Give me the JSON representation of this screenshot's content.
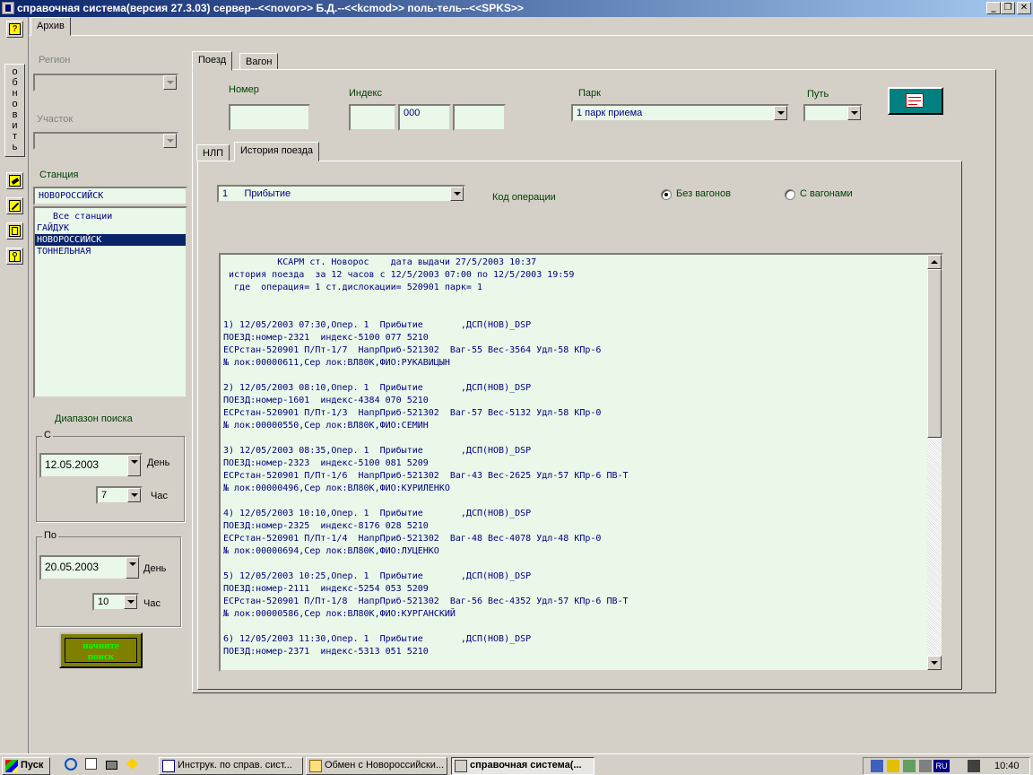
{
  "window": {
    "title": "справочная система(версия 27.3.03) сервер--<<novor>> Б.Д.--<<kcmod>> поль-тель--<<SPKS>>",
    "controls": [
      "_",
      "❐",
      "✕"
    ]
  },
  "toolbar": {
    "help_label": "?",
    "refresh_label": "о\nб\nн\nо\nв\nи\nт\nь",
    "icons": [
      "eraser-icon",
      "pencil-icon",
      "cabinet-icon",
      "key-icon"
    ]
  },
  "top_tab": {
    "label": "Архив"
  },
  "left": {
    "region_label": "Регион",
    "region_value": "",
    "section_label": "Участок",
    "section_value": "",
    "station_label": "Станция",
    "station_value": "НОВОРОССИЙСК",
    "stations": [
      "   Все станции",
      "ГАЙДУК",
      "НОВОРОССИЙСК",
      "ТОННЕЛЬНАЯ"
    ],
    "selected_station_index": 2,
    "range_label": "Диапазон поиска",
    "from": {
      "group_label": "С",
      "date": "12.05.2003",
      "day_label": "День",
      "hour": "7",
      "hour_label": "Час"
    },
    "to": {
      "group_label": "По",
      "date": "20.05.2003",
      "day_label": "День",
      "hour": "10",
      "hour_label": "Час"
    },
    "start_button": "начните\nпоиск"
  },
  "main": {
    "tabs": [
      "Поезд",
      "Вагон"
    ],
    "number_label": "Номер",
    "number_value": "",
    "index_label": "Индекс",
    "index_values": [
      "",
      "000",
      ""
    ],
    "park_label": "Парк",
    "park_value": "1  парк приема",
    "track_label": "Путь",
    "track_value": "",
    "subtabs": [
      "НЛП",
      "История поезда"
    ],
    "operation_value": "1      Прибытие",
    "operation_label": "Код операции",
    "radio_without": "Без вагонов",
    "radio_with": "С вагонами",
    "radio_selected": "without"
  },
  "report": {
    "lines": [
      "          КСАРМ ст. Новорос    дата выдачи 27/5/2003 10:37",
      " история поезда  за 12 часов с 12/5/2003 07:00 по 12/5/2003 19:59",
      "  где  операция= 1 ст.дислокации= 520901 парк= 1",
      "",
      "",
      "1) 12/05/2003 07:30,Опер. 1  Прибытие       ,ДСП(НОВ)_DSP",
      "ПОЕЗД:номер-2321  индекс-5100 077 5210",
      "ЕСРстан-520901 П/Пт-1/7  НапрПриб-521302  Ваг-55 Вес-3564 Удл-58 КПр-6",
      "№ лок:00000611,Сер лок:ВЛ80К,ФИО:РУКАВИЦЫН",
      "",
      "2) 12/05/2003 08:10,Опер. 1  Прибытие       ,ДСП(НОВ)_DSP",
      "ПОЕЗД:номер-1601  индекс-4384 070 5210",
      "ЕСРстан-520901 П/Пт-1/3  НапрПриб-521302  Ваг-57 Вес-5132 Удл-58 КПр-0",
      "№ лок:00000550,Сер лок:ВЛ80К,ФИО:СЕМИН",
      "",
      "3) 12/05/2003 08:35,Опер. 1  Прибытие       ,ДСП(НОВ)_DSP",
      "ПОЕЗД:номер-2323  индекс-5100 081 5209",
      "ЕСРстан-520901 П/Пт-1/6  НапрПриб-521302  Ваг-43 Вес-2625 Удл-57 КПр-6 ПВ-Т",
      "№ лок:00000496,Сер лок:ВЛ80К,ФИО:КУРИЛЕНКО",
      "",
      "4) 12/05/2003 10:10,Опер. 1  Прибытие       ,ДСП(НОВ)_DSP",
      "ПОЕЗД:номер-2325  индекс-8176 028 5210",
      "ЕСРстан-520901 П/Пт-1/4  НапрПриб-521302  Ваг-48 Вес-4078 Удл-48 КПр-0",
      "№ лок:00000694,Сер лок:ВЛ80К,ФИО:ЛУЦЕНКО",
      "",
      "5) 12/05/2003 10:25,Опер. 1  Прибытие       ,ДСП(НОВ)_DSP",
      "ПОЕЗД:номер-2111  индекс-5254 053 5209",
      "ЕСРстан-520901 П/Пт-1/8  НапрПриб-521302  Ваг-56 Вес-4352 Удл-57 КПр-6 ПВ-Т",
      "№ лок:00000586,Сер лок:ВЛ80К,ФИО:КУРГАНСКИЙ",
      "",
      "6) 12/05/2003 11:30,Опер. 1  Прибытие       ,ДСП(НОВ)_DSP",
      "ПОЕЗД:номер-2371  индекс-5313 051 5210"
    ]
  },
  "taskbar": {
    "start_label": "Пуск",
    "tasks": [
      "Инструк. по справ. сист...",
      "Обмен с Новороссийски...",
      "справочная система(..."
    ],
    "active_task": 2,
    "lang": "RU",
    "clock": "10:40"
  },
  "colors": {
    "field_bg": "#e9f8e8",
    "text_blue": "#000080",
    "selection": "#0a246a",
    "button_olive": "#808000",
    "button_text": "#00ff00"
  }
}
